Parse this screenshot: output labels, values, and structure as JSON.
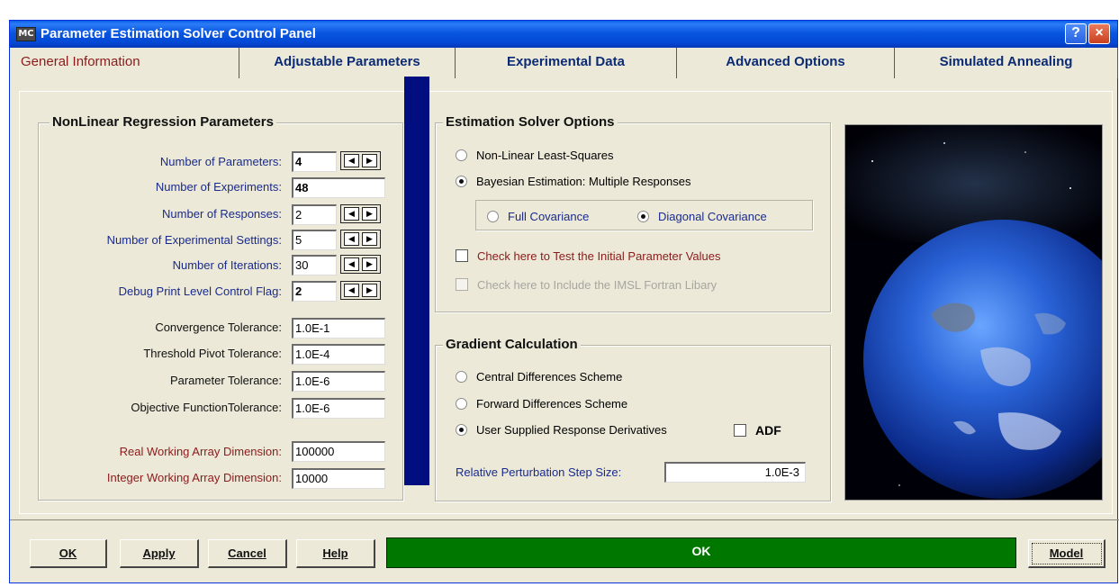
{
  "window": {
    "app_icon": "MC",
    "title": "Parameter Estimation Solver Control Panel",
    "help_label": "?",
    "close_label": "×"
  },
  "tabs": [
    {
      "label": "General Information",
      "active": true
    },
    {
      "label": "Adjustable Parameters",
      "active": false
    },
    {
      "label": "Experimental Data",
      "active": false
    },
    {
      "label": "Advanced Options",
      "active": false
    },
    {
      "label": "Simulated Annealing",
      "active": false
    }
  ],
  "regression": {
    "title": "NonLinear Regression  Parameters",
    "rows": [
      {
        "label": "Number of Parameters:",
        "value": "4",
        "spinner": true
      },
      {
        "label": "Number of Experiments:",
        "value": "48",
        "spinner": false
      },
      {
        "label": "Number of Responses:",
        "value": "2",
        "spinner": true
      },
      {
        "label": "Number of Experimental Settings:",
        "value": "5",
        "spinner": true
      },
      {
        "label": "Number of Iterations:",
        "value": "30",
        "spinner": true
      },
      {
        "label": "Debug Print Level Control Flag:",
        "value": "2",
        "spinner": true
      }
    ],
    "tolerances": [
      {
        "label": "Convergence Tolerance:",
        "value": "1.0E-1"
      },
      {
        "label": "Threshold Pivot Tolerance:",
        "value": "1.0E-4"
      },
      {
        "label": "Parameter Tolerance:",
        "value": "1.0E-6"
      },
      {
        "label": "Objective FunctionTolerance:",
        "value": "1.0E-6"
      }
    ],
    "arrays": [
      {
        "label": "Real Working Array Dimension:",
        "value": "100000"
      },
      {
        "label": "Integer Working Array Dimension:",
        "value": "10000"
      }
    ]
  },
  "solver_options": {
    "title": "Estimation Solver Options",
    "nlls_label": "Non-Linear Least-Squares",
    "bayes_label": "Bayesian Estimation: Multiple Responses",
    "full_cov_label": "Full Covariance",
    "diag_cov_label": "Diagonal Covariance",
    "test_initial_label": "Check here to Test the Initial Parameter Values",
    "imsl_label": "Check here to Include the IMSL Fortran Libary"
  },
  "gradient": {
    "title": "Gradient Calculation",
    "central_label": "Central Differences Scheme",
    "forward_label": "Forward Differences Scheme",
    "user_label": "User Supplied Response Derivatives",
    "adf_label": "ADF",
    "step_label": "Relative Perturbation Step Size:",
    "step_value": "1.0E-3"
  },
  "buttons": {
    "ok": "OK",
    "apply": "Apply",
    "cancel": "Cancel",
    "help": "Help",
    "model": "Model"
  },
  "status_text": "OK",
  "icons": {
    "spinner_left": "◀",
    "spinner_right": "▶"
  }
}
